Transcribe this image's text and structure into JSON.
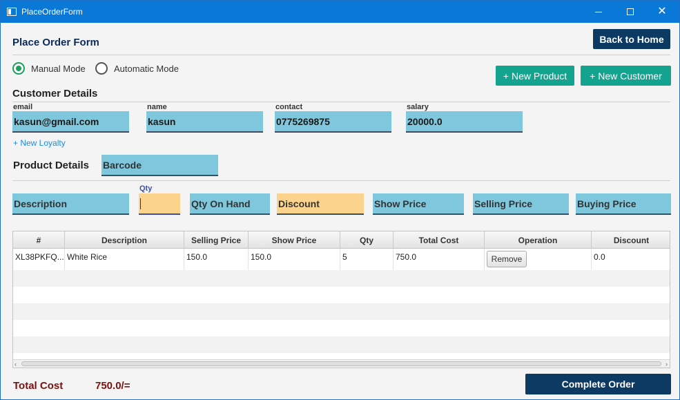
{
  "window": {
    "title": "PlaceOrderForm"
  },
  "header": {
    "title": "Place Order Form",
    "back_label": "Back to Home"
  },
  "mode": {
    "manual_label": "Manual Mode",
    "automatic_label": "Automatic Mode",
    "selected": "Manual Mode"
  },
  "actions": {
    "new_product": "+ New Product",
    "new_customer": "+ New Customer"
  },
  "customer": {
    "section_title": "Customer Details",
    "email_label": "email",
    "email_value": "kasun@gmail.com",
    "name_label": "name",
    "name_value": "kasun",
    "contact_label": "contact",
    "contact_value": "0775269875",
    "salary_label": "salary",
    "salary_value": "20000.0",
    "new_loyalty": "+ New Loyalty"
  },
  "product": {
    "section_title": "Product Details",
    "barcode_placeholder": "Barcode",
    "description_placeholder": "Description",
    "qty_label": "Qty",
    "qty_on_hand_placeholder": "Qty On Hand",
    "discount_placeholder": "Discount",
    "show_price_placeholder": "Show Price",
    "selling_price_placeholder": "Selling Price",
    "buying_price_placeholder": "Buying Price"
  },
  "table": {
    "columns": [
      "#",
      "Description",
      "Selling Price",
      "Show Price",
      "Qty",
      "Total Cost",
      "Operation",
      "Discount"
    ],
    "rows": [
      {
        "id": "XL38PKFQ...",
        "description": "White Rice",
        "selling_price": "150.0",
        "show_price": "150.0",
        "qty": "5",
        "total_cost": "750.0",
        "operation": "Remove",
        "discount": "0.0"
      }
    ]
  },
  "footer": {
    "total_label": "Total Cost",
    "total_value": "750.0/=",
    "complete_label": "Complete Order"
  },
  "colors": {
    "accent_dark": "#0d3a63",
    "accent_teal": "#13a38f",
    "field_blue": "#7fc7dc",
    "field_orange": "#fbd38c",
    "total_red": "#7a1010"
  }
}
